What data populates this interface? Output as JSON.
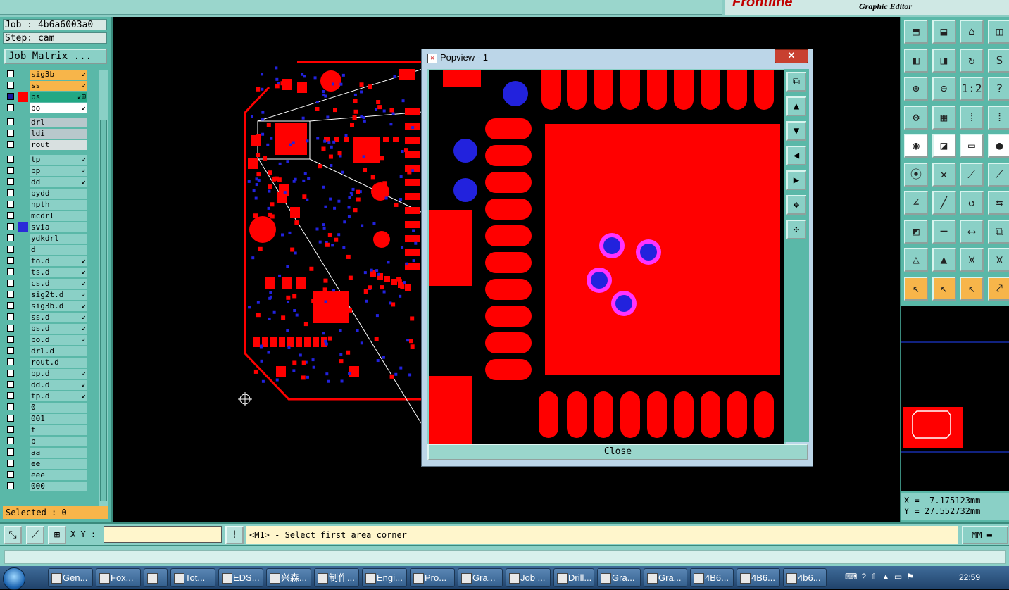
{
  "brand": {
    "logo": "Frontline",
    "subtitle": "Graphic Editor"
  },
  "job": {
    "job_line": "Job : 4b6a6003a0",
    "step_line": "Step: cam",
    "job_matrix_label": "Job Matrix ..."
  },
  "layers": [
    {
      "name": "sig3b",
      "bg": "#f7b54a",
      "swatch": "",
      "mark": "↙"
    },
    {
      "name": "ss",
      "bg": "#f7b54a",
      "swatch": "",
      "mark": "↙"
    },
    {
      "name": "bs",
      "bg": "#22a884",
      "swatch": "#ff0000",
      "mark": "↙⊞"
    },
    {
      "name": "bo",
      "bg": "#ffffff",
      "swatch": "",
      "mark": "↙"
    },
    {
      "name": "drl",
      "bg": "#b8c8cc",
      "swatch": "",
      "mark": ""
    },
    {
      "name": "ldi",
      "bg": "#b8c8cc",
      "swatch": "",
      "mark": ""
    },
    {
      "name": "rout",
      "bg": "#d8e0e0",
      "swatch": "",
      "mark": ""
    },
    {
      "name": "tp",
      "bg": "#8ad0c6",
      "swatch": "",
      "mark": "↙"
    },
    {
      "name": "bp",
      "bg": "#8ad0c6",
      "swatch": "",
      "mark": "↙"
    },
    {
      "name": "dd",
      "bg": "#8ad0c6",
      "swatch": "",
      "mark": "↙"
    },
    {
      "name": "bydd",
      "bg": "#8ad0c6",
      "swatch": "",
      "mark": ""
    },
    {
      "name": "npth",
      "bg": "#8ad0c6",
      "swatch": "",
      "mark": ""
    },
    {
      "name": "mcdrl",
      "bg": "#8ad0c6",
      "swatch": "",
      "mark": ""
    },
    {
      "name": "svia",
      "bg": "#8ad0c6",
      "swatch": "#2a2ad8",
      "mark": ""
    },
    {
      "name": "ydkdrl",
      "bg": "#8ad0c6",
      "swatch": "",
      "mark": ""
    },
    {
      "name": "d",
      "bg": "#8ad0c6",
      "swatch": "",
      "mark": ""
    },
    {
      "name": "to.d",
      "bg": "#8ad0c6",
      "swatch": "",
      "mark": "↙"
    },
    {
      "name": "ts.d",
      "bg": "#8ad0c6",
      "swatch": "",
      "mark": "↙"
    },
    {
      "name": "cs.d",
      "bg": "#8ad0c6",
      "swatch": "",
      "mark": "↙"
    },
    {
      "name": "sig2t.d",
      "bg": "#8ad0c6",
      "swatch": "",
      "mark": "↙"
    },
    {
      "name": "sig3b.d",
      "bg": "#8ad0c6",
      "swatch": "",
      "mark": "↙"
    },
    {
      "name": "ss.d",
      "bg": "#8ad0c6",
      "swatch": "",
      "mark": "↙"
    },
    {
      "name": "bs.d",
      "bg": "#8ad0c6",
      "swatch": "",
      "mark": "↙"
    },
    {
      "name": "bo.d",
      "bg": "#8ad0c6",
      "swatch": "",
      "mark": "↙"
    },
    {
      "name": "drl.d",
      "bg": "#8ad0c6",
      "swatch": "",
      "mark": ""
    },
    {
      "name": "rout.d",
      "bg": "#8ad0c6",
      "swatch": "",
      "mark": ""
    },
    {
      "name": "bp.d",
      "bg": "#8ad0c6",
      "swatch": "",
      "mark": "↙"
    },
    {
      "name": "dd.d",
      "bg": "#8ad0c6",
      "swatch": "",
      "mark": "↙"
    },
    {
      "name": "tp.d",
      "bg": "#8ad0c6",
      "swatch": "",
      "mark": "↙"
    },
    {
      "name": "0",
      "bg": "#8ad0c6",
      "swatch": "",
      "mark": ""
    },
    {
      "name": "001",
      "bg": "#8ad0c6",
      "swatch": "",
      "mark": ""
    },
    {
      "name": "t",
      "bg": "#8ad0c6",
      "swatch": "",
      "mark": ""
    },
    {
      "name": "b",
      "bg": "#8ad0c6",
      "swatch": "",
      "mark": ""
    },
    {
      "name": "aa",
      "bg": "#8ad0c6",
      "swatch": "",
      "mark": ""
    },
    {
      "name": "ee",
      "bg": "#8ad0c6",
      "swatch": "",
      "mark": ""
    },
    {
      "name": "eee",
      "bg": "#8ad0c6",
      "swatch": "",
      "mark": ""
    },
    {
      "name": "000",
      "bg": "#8ad0c6",
      "swatch": "",
      "mark": ""
    }
  ],
  "selected_label": "Selected : 0",
  "popview": {
    "title": "Popview - 1",
    "close_x": "✕",
    "close_button": "Close"
  },
  "coords": {
    "x": "X = -7.175123mm",
    "y": "Y = 27.552732mm"
  },
  "command": {
    "xy_label": "X Y :",
    "xy_value": "",
    "prompt": "<M1> - Select first area corner",
    "units": "MM"
  },
  "taskbar": {
    "items": [
      "Gen...",
      "Fox...",
      "",
      "Tot...",
      "EDS...",
      "兴森...",
      "制作...",
      "Engi...",
      "Pro...",
      "Gra...",
      "Job ...",
      "Drill...",
      "Gra...",
      "Gra...",
      "4B6...",
      "4B6...",
      "4b6..."
    ],
    "clock": "22:59"
  },
  "colors": {
    "pad": "#ff0000",
    "via": "#2222dd",
    "via_ring": "#ff33ff",
    "panel": "#5ab8a8",
    "button": "#8ad0c6"
  }
}
